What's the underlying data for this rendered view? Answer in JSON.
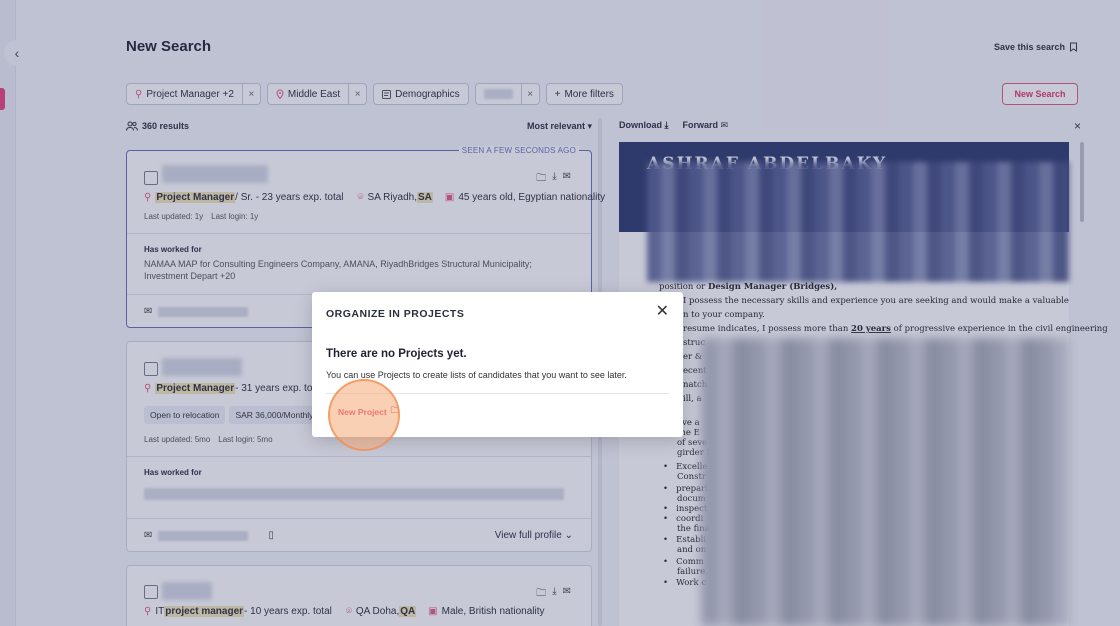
{
  "page": {
    "title": "New Search",
    "save_search": "Save this search",
    "new_search": "New Search",
    "collapse_icon": "‹"
  },
  "filters": {
    "role": "Project Manager +2",
    "location": "Middle East",
    "demographics": "Demographics",
    "more": "More filters",
    "remove": "×"
  },
  "results": {
    "count": "360 results",
    "sort": "Most relevant"
  },
  "cards": [
    {
      "seen": "SEEN A FEW SECONDS AGO",
      "role_hl": "Project Manager",
      "role_rest": " / Sr. - 23 years exp. total",
      "loc_city": "SA Riyadh, ",
      "loc_hl": "SA",
      "demo": "45 years old, Egyptian nationality",
      "updated": "Last updated: 1y",
      "login": "Last login: 1y",
      "worked_title": "Has worked for",
      "worked": "NAMAA MAP for Consulting Engineers Company, AMANA, RiyadhBridges Structural Municipality; Investment Depart +20"
    },
    {
      "role_hl": "Project Manager",
      "role_rest": " - 31 years exp. total",
      "tag1": "Open to relocation",
      "tag2": "SAR 36,000/Monthly",
      "updated": "Last updated: 5mo",
      "login": "Last login: 5mo",
      "worked_title": "Has worked for",
      "view_full": "View full profile"
    },
    {
      "role_pre": "IT ",
      "role_hl": "project manager",
      "role_rest": " - 10 years exp. total",
      "loc_city": "QA Doha, ",
      "loc_hl": "QA",
      "demo": "Male, British nationality"
    }
  ],
  "preview": {
    "download": "Download",
    "forward": "Forward",
    "close": "×",
    "header_title": "ASHRAF ABDELBAKY",
    "lines": [
      {
        "text_a": "position or ",
        "bold": "Design Manager (Bridges),",
        "text_b": ""
      },
      {
        "text_a": "I possess the necessary skills and experience you are seeking and would make a valuable",
        "bold": "",
        "text_b": ""
      },
      {
        "text_a": "n to your company.",
        "bold": "",
        "text_b": ""
      },
      {
        "text_a": "resume indicates, I possess more than ",
        "bold": "20 years",
        "text_b": " of progressive experience in the civil engineering"
      },
      {
        "text_a": "struc",
        "bold": "",
        "text_b": ""
      },
      {
        "text_a": "er &",
        "bold": "",
        "text_b": ""
      },
      {
        "text_a": "ecent",
        "bold": "",
        "text_b": ""
      },
      {
        "text_a": "natch",
        "bold": "",
        "text_b": ""
      },
      {
        "text_a": "ill, a",
        "bold": "",
        "text_b": ""
      }
    ],
    "bullets": [
      "Excelle",
      "Constr",
      "prepari",
      "docum",
      "inspect",
      "coordi",
      "the fina",
      "Establi",
      "and on",
      "Comm",
      "failure.",
      "Work c"
    ],
    "sub_lines": [
      "ave a",
      "the E",
      "of seve",
      "girder I"
    ]
  },
  "modal": {
    "title": "ORGANIZE IN PROJECTS",
    "heading": "There are no Projects yet.",
    "desc": "You can use Projects to create lists of candidates that you want to see later.",
    "new_project": "New Project",
    "close": "✕"
  }
}
